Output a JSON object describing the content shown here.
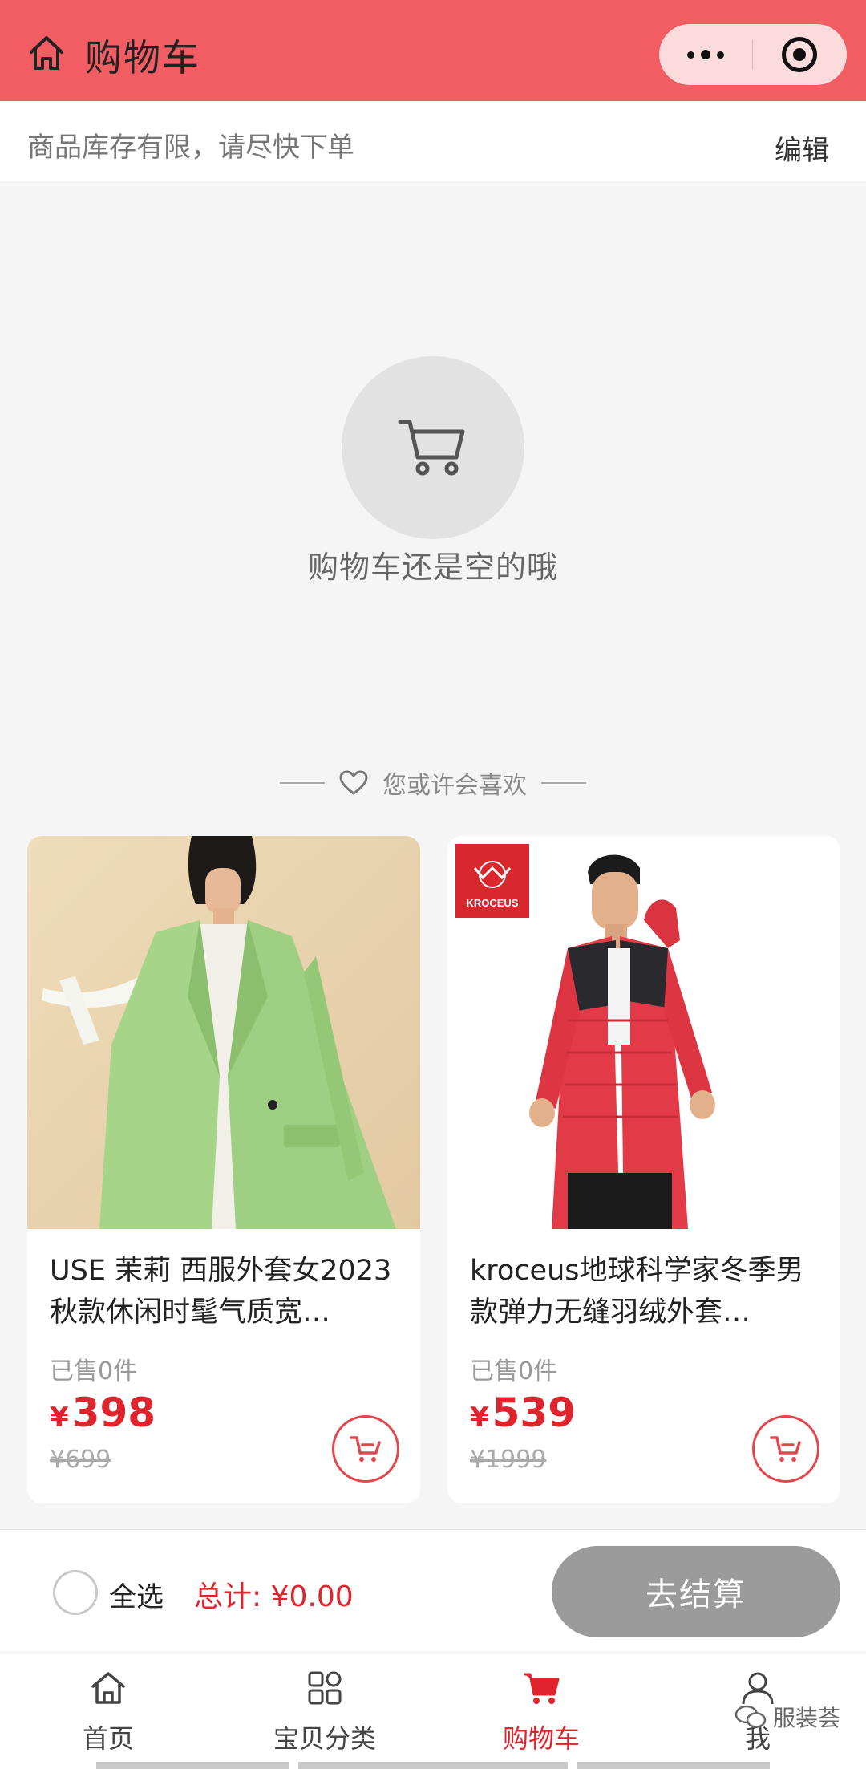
{
  "header": {
    "title": "购物车",
    "home_icon": "home-icon",
    "menu_icon": "more-dots-icon",
    "close_icon": "target-icon"
  },
  "notice": {
    "text": "商品库存有限，请尽快下单",
    "edit_label": "编辑"
  },
  "empty_state": {
    "icon": "cart-icon",
    "text": "购物车还是空的哦"
  },
  "recommend": {
    "icon": "heart-icon",
    "label": "您或许会喜欢"
  },
  "products": [
    {
      "title": "USE 茉莉 西服外套女2023秋款休闲时髦气质宽…",
      "sold": "已售0件",
      "price_symbol": "¥",
      "price": "398",
      "original_price": "¥699"
    },
    {
      "title": "kroceus地球科学家冬季男款弹力无缝羽绒外套…",
      "sold": "已售0件",
      "price_symbol": "¥",
      "price": "539",
      "original_price": "¥1999",
      "brand_badge": "KROCEUS"
    }
  ],
  "checkout": {
    "select_all_label": "全选",
    "total": "总计: ¥0.00",
    "button_label": "去结算"
  },
  "tabbar": {
    "tabs": [
      {
        "label": "首页",
        "icon": "home-icon"
      },
      {
        "label": "宝贝分类",
        "icon": "category-icon"
      },
      {
        "label": "购物车",
        "icon": "cart-icon",
        "active": true
      },
      {
        "label": "我",
        "icon": "user-icon"
      }
    ],
    "watermark": "服装荟"
  },
  "colors": {
    "accent": "#f25d63",
    "price_red": "#e0242e",
    "checkout_disabled": "#9b9b9b",
    "background": "#f5f5f5"
  }
}
